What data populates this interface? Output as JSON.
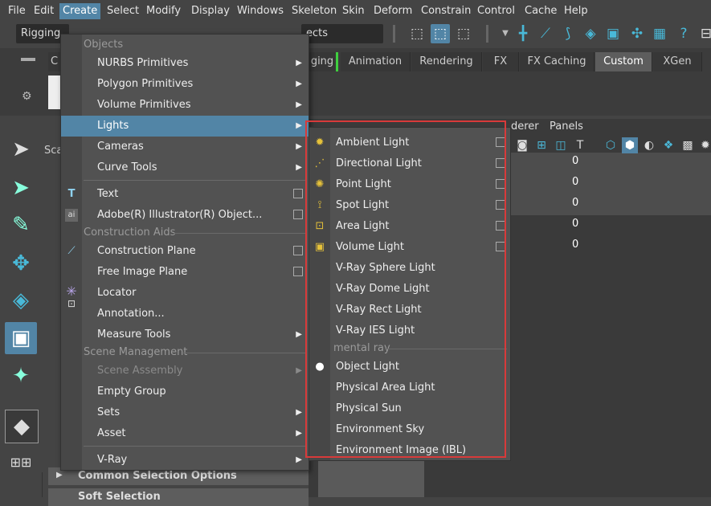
{
  "menubar": {
    "items": [
      "File",
      "Edit",
      "Create",
      "Select",
      "Modify",
      "Display",
      "Windows",
      "Skeleton",
      "Skin",
      "Deform",
      "Constrain",
      "Control",
      "Cache",
      "Help"
    ],
    "active": "Create"
  },
  "statusline": {
    "mode_value": "Rigging",
    "objects_field": "ects"
  },
  "shelf": {
    "tabs": [
      "ging",
      "Animation",
      "Rendering",
      "FX",
      "FX Caching",
      "Custom",
      "XGen"
    ],
    "active_tab": "Custom",
    "left_tab": "C"
  },
  "scene_label": "Sca",
  "viewport": {
    "menu_items": [
      "derer",
      "Panels"
    ],
    "values": [
      "0",
      "0",
      "0",
      "0",
      "0"
    ]
  },
  "create_menu": {
    "sections": {
      "objects": "Objects",
      "construction_aids": "Construction Aids",
      "scene_management": "Scene Management"
    },
    "items": [
      {
        "label": "NURBS Primitives",
        "type": "submenu"
      },
      {
        "label": "Polygon Primitives",
        "type": "submenu"
      },
      {
        "label": "Volume Primitives",
        "type": "submenu"
      },
      {
        "label": "Lights",
        "type": "submenu",
        "highlighted": true
      },
      {
        "label": "Cameras",
        "type": "submenu"
      },
      {
        "label": "Curve Tools",
        "type": "submenu"
      },
      {
        "label": "Text",
        "type": "option"
      },
      {
        "label": "Adobe(R) Illustrator(R) Object...",
        "type": "option"
      },
      {
        "label": "Construction Plane",
        "type": "option"
      },
      {
        "label": "Free Image Plane",
        "type": "option"
      },
      {
        "label": "Locator",
        "type": "plain"
      },
      {
        "label": "Annotation...",
        "type": "plain"
      },
      {
        "label": "Measure Tools",
        "type": "submenu"
      },
      {
        "label": "Scene Assembly",
        "type": "submenu",
        "disabled": true
      },
      {
        "label": "Empty Group",
        "type": "plain"
      },
      {
        "label": "Sets",
        "type": "submenu"
      },
      {
        "label": "Asset",
        "type": "submenu"
      },
      {
        "label": "V-Ray",
        "type": "submenu"
      }
    ]
  },
  "lights_menu": {
    "items": [
      {
        "label": "Ambient Light",
        "icon": "ambient-light-icon",
        "option": true
      },
      {
        "label": "Directional Light",
        "icon": "directional-light-icon",
        "option": true
      },
      {
        "label": "Point Light",
        "icon": "point-light-icon",
        "option": true
      },
      {
        "label": "Spot Light",
        "icon": "spot-light-icon",
        "option": true
      },
      {
        "label": "Area Light",
        "icon": "area-light-icon",
        "option": true
      },
      {
        "label": "Volume Light",
        "icon": "volume-light-icon",
        "option": true
      },
      {
        "label": "V-Ray Sphere Light",
        "option": false
      },
      {
        "label": "V-Ray Dome Light",
        "option": false
      },
      {
        "label": "V-Ray Rect Light",
        "option": false
      },
      {
        "label": "V-Ray IES Light",
        "option": false
      }
    ],
    "mental_ray_section": "mental ray",
    "mental_ray_items": [
      {
        "label": "Object Light",
        "icon": "bulb-icon"
      },
      {
        "label": "Physical Area Light"
      },
      {
        "label": "Physical Sun"
      },
      {
        "label": "Environment Sky"
      },
      {
        "label": "Environment Image (IBL)"
      }
    ]
  },
  "attribute_frames": [
    "Common Selection Options",
    "Soft Selection"
  ],
  "colors": {
    "highlight": "#5285a6",
    "annotation_box": "#d83a3a",
    "accent_icon": "#49b9d8"
  }
}
